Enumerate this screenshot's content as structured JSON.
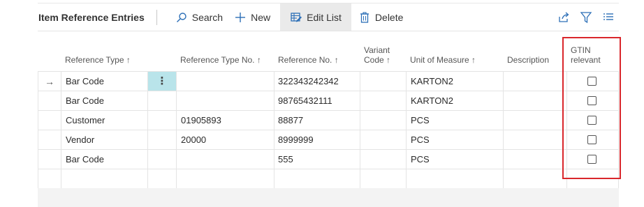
{
  "toolbar": {
    "title": "Item Reference Entries",
    "search_label": "Search",
    "new_label": "New",
    "edit_list_label": "Edit List",
    "delete_label": "Delete"
  },
  "columns": {
    "reference_type": "Reference Type ↑",
    "reference_type_no": "Reference Type No. ↑",
    "reference_no": "Reference No. ↑",
    "variant_code_1": "Variant",
    "variant_code_2": "Code ↑",
    "unit_of_measure": "Unit of Measure ↑",
    "description": "Description",
    "gtin_1": "GTIN",
    "gtin_2": "relevant"
  },
  "rows": [
    {
      "reference_type": "Bar Code",
      "reference_type_no": "",
      "reference_no": "322343242342",
      "variant_code": "",
      "unit_of_measure": "KARTON2",
      "description": "",
      "gtin_relevant": false
    },
    {
      "reference_type": "Bar Code",
      "reference_type_no": "",
      "reference_no": "98765432111",
      "variant_code": "",
      "unit_of_measure": "KARTON2",
      "description": "",
      "gtin_relevant": false
    },
    {
      "reference_type": "Customer",
      "reference_type_no": "01905893",
      "reference_no": "88877",
      "variant_code": "",
      "unit_of_measure": "PCS",
      "description": "",
      "gtin_relevant": false
    },
    {
      "reference_type": "Vendor",
      "reference_type_no": "20000",
      "reference_no": "8999999",
      "variant_code": "",
      "unit_of_measure": "PCS",
      "description": "",
      "gtin_relevant": false
    },
    {
      "reference_type": "Bar Code",
      "reference_type_no": "",
      "reference_no": "555",
      "variant_code": "",
      "unit_of_measure": "PCS",
      "description": "",
      "gtin_relevant": false
    }
  ],
  "row_indicator": "→",
  "row_actions_glyph": "⋮",
  "colors": {
    "highlight": "#d9262b",
    "selected_cell": "#b9e4ea",
    "toolbar_active": "#eaeaea",
    "icon_blue": "#2c6fb7"
  }
}
